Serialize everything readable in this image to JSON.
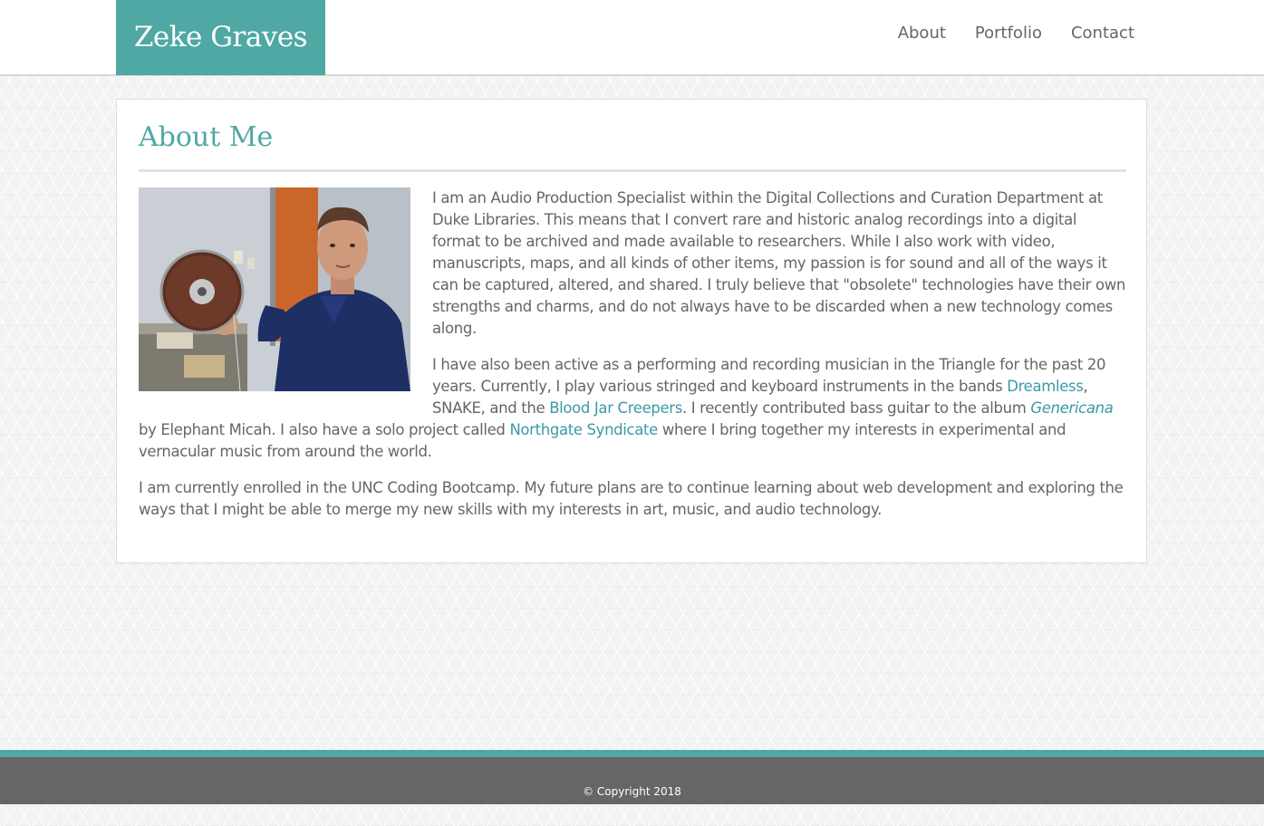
{
  "header": {
    "brand": "Zeke Graves",
    "nav": [
      "About",
      "Portfolio",
      "Contact"
    ]
  },
  "main": {
    "title": "About Me",
    "paragraph1": "I am an Audio Production Specialist within the Digital Collections and Curation Department at Duke Libraries. This means that I convert rare and historic analog recordings into a digital format to be archived and made available to researchers. While I also work with video, manuscripts, maps, and all kinds of other items, my passion is for sound and all of the ways it can be captured, altered, and shared. I truly believe that \"obsolete\" technologies have their own strengths and charms, and do not always have to be discarded when a new technology comes along.",
    "paragraph2": {
      "t1": "I have also been active as a performing and recording musician in the Triangle for the past 20 years. Currently, I play various stringed and keyboard instruments in the bands ",
      "link1": "Dreamless",
      "t2": ", SNAKE, and the ",
      "link2": "Blood Jar Creepers",
      "t3": ". I recently contributed bass guitar to the album ",
      "album": "Genericana",
      "t4": " by Elephant Micah. I also have a solo project called ",
      "link3": "Northgate Syndicate",
      "t5": " where I bring together my interests in experimental and vernacular music from around the world."
    },
    "paragraph3": "I am currently enrolled in the UNC Coding Bootcamp. My future plans are to continue learning about web development and exploring the ways that I might be able to merge my new skills with my interests in art, music, and audio technology."
  },
  "footer": {
    "copyright": "© Copyright 2018"
  },
  "colors": {
    "accent": "#4fa8a3",
    "link": "#3a9aa6",
    "text": "#666666",
    "footer": "#666666"
  }
}
